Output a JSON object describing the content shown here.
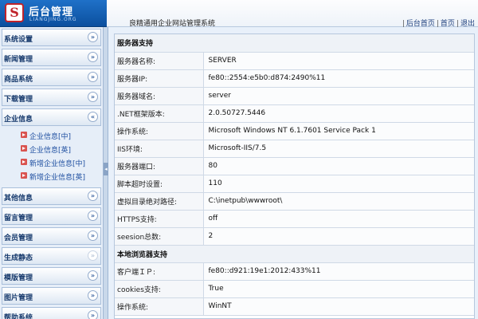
{
  "header": {
    "logo_char": "S",
    "logo_title": "后台管理",
    "logo_subtitle": "LIANGJING.ORG",
    "system_title": "良精通用企业网站管理系统",
    "links": [
      "后台首页",
      "首页",
      "退出"
    ]
  },
  "sidebar": {
    "items": [
      {
        "label": "系统设置"
      },
      {
        "label": "新闻管理"
      },
      {
        "label": "商品系统"
      },
      {
        "label": "下载管理"
      },
      {
        "label": "企业信息",
        "expanded": true,
        "children": [
          "企业信息[中]",
          "企业信息[英]",
          "新增企业信息[中]",
          "新增企业信息[英]"
        ]
      },
      {
        "label": "其他信息"
      },
      {
        "label": "留言管理"
      },
      {
        "label": "会员管理"
      },
      {
        "label": "生成静态"
      },
      {
        "label": "模版管理"
      },
      {
        "label": "图片管理"
      },
      {
        "label": "帮助系统"
      }
    ]
  },
  "main": {
    "server_section": "服务器支持",
    "server_rows": [
      {
        "k": "服务器名称:",
        "v": "SERVER"
      },
      {
        "k": "服务器IP:",
        "v": "fe80::2554:e5b0:d874:2490%11"
      },
      {
        "k": "服务器域名:",
        "v": "server"
      },
      {
        "k": ".NET框架版本:",
        "v": "2.0.50727.5446"
      },
      {
        "k": "操作系统:",
        "v": "Microsoft Windows NT 6.1.7601 Service Pack 1"
      },
      {
        "k": "IIS环境:",
        "v": "Microsoft-IIS/7.5"
      },
      {
        "k": "服务器端口:",
        "v": "80"
      },
      {
        "k": "脚本超时设置:",
        "v": "110"
      },
      {
        "k": "虚拟目录绝对路径:",
        "v": "C:\\inetpub\\wwwroot\\"
      },
      {
        "k": "HTTPS支持:",
        "v": "off"
      },
      {
        "k": "seesion总数:",
        "v": "2"
      }
    ],
    "browser_section": "本地浏览器支持",
    "browser_rows": [
      {
        "k": "客户端ＩＰ:",
        "v": "fe80::d921:19e1:2012:433%11"
      },
      {
        "k": "cookies支持:",
        "v": "True"
      },
      {
        "k": "操作系统:",
        "v": "WinNT"
      }
    ]
  }
}
